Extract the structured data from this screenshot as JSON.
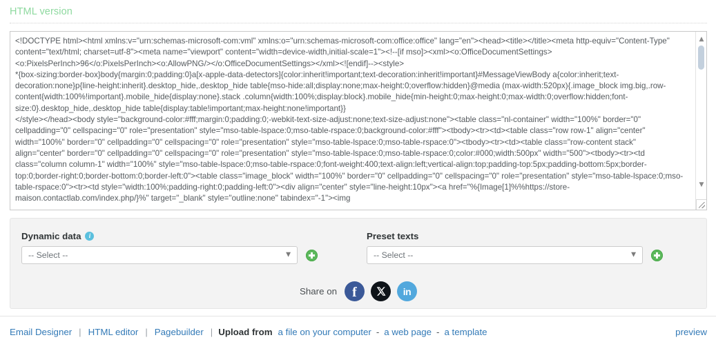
{
  "section": {
    "title": "HTML version"
  },
  "code_editor": {
    "content": "<!DOCTYPE html><html xmlns:v=\"urn:schemas-microsoft-com:vml\" xmlns:o=\"urn:schemas-microsoft-com:office:office\" lang=\"en\"><head><title></title><meta http-equiv=\"Content-Type\" content=\"text/html; charset=utf-8\"><meta name=\"viewport\" content=\"width=device-width,initial-scale=1\"><!--[if mso]><xml><o:OfficeDocumentSettings><o:PixelsPerInch>96</o:PixelsPerInch><o:AllowPNG/></o:OfficeDocumentSettings></xml><![endif]--><style>\n*{box-sizing:border-box}body{margin:0;padding:0}a[x-apple-data-detectors]{color:inherit!important;text-decoration:inherit!important}#MessageViewBody a{color:inherit;text-decoration:none}p{line-height:inherit}.desktop_hide,.desktop_hide table{mso-hide:all;display:none;max-height:0;overflow:hidden}@media (max-width:520px){.image_block img.big,.row-content{width:100%!important}.mobile_hide{display:none}.stack .column{width:100%;display:block}.mobile_hide{min-height:0;max-height:0;max-width:0;overflow:hidden;font-size:0}.desktop_hide,.desktop_hide table{display:table!important;max-height:none!important}}\n</style></head><body style=\"background-color:#fff;margin:0;padding:0;-webkit-text-size-adjust:none;text-size-adjust:none\"><table class=\"nl-container\" width=\"100%\" border=\"0\" cellpadding=\"0\" cellspacing=\"0\" role=\"presentation\" style=\"mso-table-lspace:0;mso-table-rspace:0;background-color:#fff\"><tbody><tr><td><table class=\"row row-1\" align=\"center\" width=\"100%\" border=\"0\" cellpadding=\"0\" cellspacing=\"0\" role=\"presentation\" style=\"mso-table-lspace:0;mso-table-rspace:0\"><tbody><tr><td><table class=\"row-content stack\" align=\"center\" border=\"0\" cellpadding=\"0\" cellspacing=\"0\" role=\"presentation\" style=\"mso-table-lspace:0;mso-table-rspace:0;color:#000;width:500px\" width=\"500\"><tbody><tr><td class=\"column column-1\" width=\"100%\" style=\"mso-table-lspace:0;mso-table-rspace:0;font-weight:400;text-align:left;vertical-align:top;padding-top:5px;padding-bottom:5px;border-top:0;border-right:0;border-bottom:0;border-left:0\"><table class=\"image_block\" width=\"100%\" border=\"0\" cellpadding=\"0\" cellspacing=\"0\" role=\"presentation\" style=\"mso-table-lspace:0;mso-table-rspace:0\"><tr><td style=\"width:100%;padding-right:0;padding-left:0\"><div align=\"center\" style=\"line-height:10px\"><a href=\"%{Image[1]%%https://store-maison.contactlab.com/index.php/}%\" target=\"_blank\" style=\"outline:none\" tabindex=\"-1\"><img"
  },
  "panel": {
    "dynamic_data": {
      "label": "Dynamic data",
      "info_icon": "info-icon",
      "select_value": "-- Select --",
      "add_icon": "plus-circle-icon"
    },
    "preset_texts": {
      "label": "Preset texts",
      "select_value": "-- Select --",
      "add_icon": "plus-circle-icon"
    },
    "share": {
      "label": "Share on",
      "networks": [
        {
          "name": "facebook",
          "glyph": "f"
        },
        {
          "name": "x-twitter",
          "glyph": "✕"
        },
        {
          "name": "linkedin",
          "glyph": "in"
        }
      ]
    }
  },
  "footer": {
    "email_designer": "Email Designer",
    "html_editor": "HTML editor",
    "pagebuilder": "Pagebuilder",
    "upload_from": "Upload from",
    "file_on_computer": "a file on your computer",
    "web_page": "a web page",
    "template": "a template",
    "separator": "|",
    "dash": "-",
    "preview": "preview"
  },
  "colors": {
    "title_green": "#8ed99f",
    "link_blue": "#337ab7",
    "panel_gray": "#f3f3f3",
    "add_green": "#5cb85c",
    "info_blue": "#5bc0de",
    "facebook": "#3b5998",
    "x": "#0f1419",
    "linkedin": "#52a8dd"
  }
}
